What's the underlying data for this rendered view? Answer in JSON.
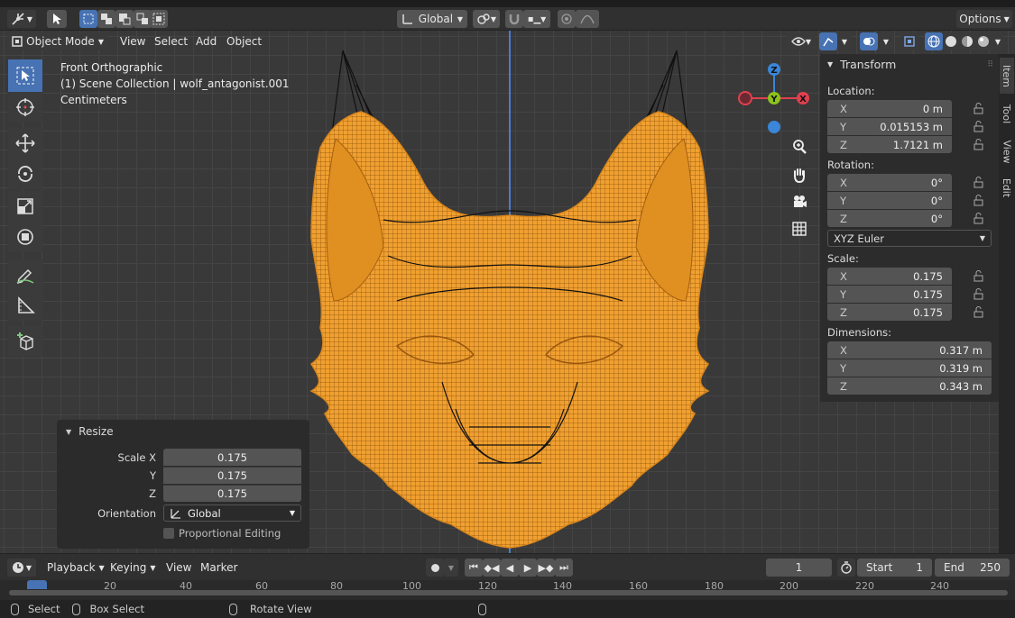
{
  "header": {
    "transform_orientation": "Global",
    "options_label": "Options"
  },
  "viewport_header": {
    "mode": "Object Mode",
    "menus": [
      "View",
      "Select",
      "Add",
      "Object"
    ]
  },
  "overlay_text": {
    "view_name": "Front Orthographic",
    "collection": "(1) Scene Collection | wolf_antagonist.001",
    "units": "Centimeters"
  },
  "gizmo": {
    "x": "X",
    "y": "Y",
    "z": "Z"
  },
  "sidebar": {
    "panel_title": "Transform",
    "tabs": [
      "Item",
      "Tool",
      "View",
      "Edit"
    ],
    "location_label": "Location:",
    "location": [
      {
        "axis": "X",
        "value": "0 m"
      },
      {
        "axis": "Y",
        "value": "0.015153 m"
      },
      {
        "axis": "Z",
        "value": "1.7121 m"
      }
    ],
    "rotation_label": "Rotation:",
    "rotation": [
      {
        "axis": "X",
        "value": "0°"
      },
      {
        "axis": "Y",
        "value": "0°"
      },
      {
        "axis": "Z",
        "value": "0°"
      }
    ],
    "rotation_mode": "XYZ Euler",
    "scale_label": "Scale:",
    "scale": [
      {
        "axis": "X",
        "value": "0.175"
      },
      {
        "axis": "Y",
        "value": "0.175"
      },
      {
        "axis": "Z",
        "value": "0.175"
      }
    ],
    "dimensions_label": "Dimensions:",
    "dimensions": [
      {
        "axis": "X",
        "value": "0.317 m"
      },
      {
        "axis": "Y",
        "value": "0.319 m"
      },
      {
        "axis": "Z",
        "value": "0.343 m"
      }
    ]
  },
  "resize_panel": {
    "title": "Resize",
    "scale_x_label": "Scale X",
    "y_label": "Y",
    "z_label": "Z",
    "scale_x": "0.175",
    "scale_y": "0.175",
    "scale_z": "0.175",
    "orientation_label": "Orientation",
    "orientation": "Global",
    "proportional_label": "Proportional Editing"
  },
  "timeline": {
    "menus": [
      "Playback",
      "Keying",
      "View",
      "Marker"
    ],
    "current_frame": "1",
    "start_label": "Start",
    "start": "1",
    "end_label": "End",
    "end": "250",
    "ticks": [
      "20",
      "40",
      "60",
      "80",
      "100",
      "120",
      "140",
      "160",
      "180",
      "200",
      "220",
      "240"
    ]
  },
  "statusbar": {
    "select": "Select",
    "box_select": "Box Select",
    "rotate_view": "Rotate View"
  },
  "colors": {
    "accent": "#4772b3",
    "selected_object": "#f5a030",
    "axis_x": "#e0404e",
    "axis_y": "#8cc21a",
    "axis_z": "#3a86d8"
  }
}
